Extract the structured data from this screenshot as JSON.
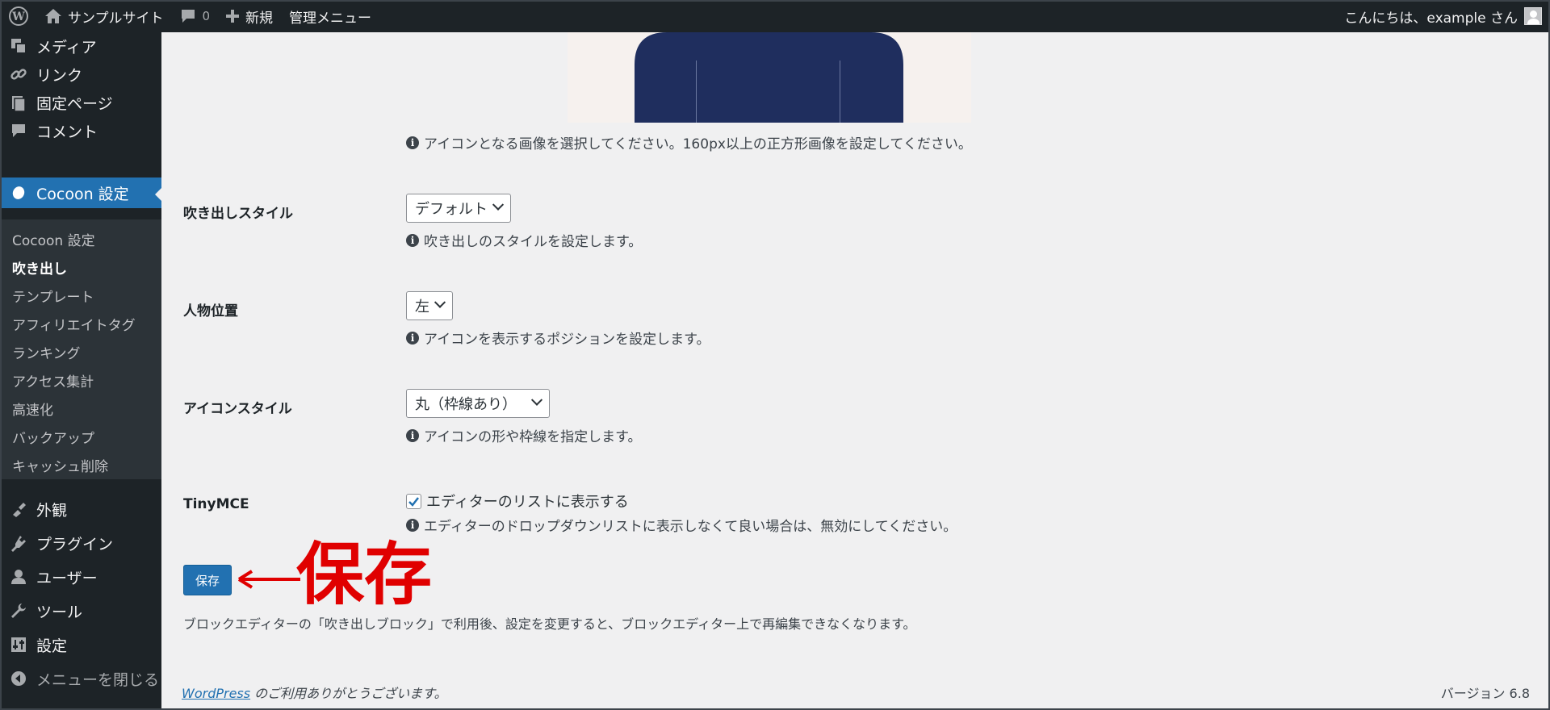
{
  "admin_bar": {
    "site_name": "サンプルサイト",
    "comment_count": "0",
    "new_label": "新規",
    "admin_menu_label": "管理メニュー",
    "greeting": "こんにちは、example さん"
  },
  "sidebar": {
    "items_top": [
      {
        "label": "メディア",
        "icon": "media-icon"
      },
      {
        "label": "リンク",
        "icon": "link-icon"
      },
      {
        "label": "固定ページ",
        "icon": "page-icon"
      },
      {
        "label": "コメント",
        "icon": "comment-icon"
      }
    ],
    "current": {
      "label": "Cocoon 設定",
      "icon": "cocoon-icon"
    },
    "submenu": [
      {
        "label": "Cocoon 設定",
        "current": false
      },
      {
        "label": "吹き出し",
        "current": true
      },
      {
        "label": "テンプレート",
        "current": false
      },
      {
        "label": "アフィリエイトタグ",
        "current": false
      },
      {
        "label": "ランキング",
        "current": false
      },
      {
        "label": "アクセス集計",
        "current": false
      },
      {
        "label": "高速化",
        "current": false
      },
      {
        "label": "バックアップ",
        "current": false
      },
      {
        "label": "キャッシュ削除",
        "current": false
      }
    ],
    "items_bottom": [
      {
        "label": "外観",
        "icon": "appearance-icon"
      },
      {
        "label": "プラグイン",
        "icon": "plugin-icon"
      },
      {
        "label": "ユーザー",
        "icon": "user-icon"
      },
      {
        "label": "ツール",
        "icon": "tool-icon"
      },
      {
        "label": "設定",
        "icon": "settings-icon"
      }
    ],
    "collapse_label": "メニューを閉じる"
  },
  "form": {
    "icon_desc": "アイコンとなる画像を選択してください。160px以上の正方形画像を設定してください。",
    "balloon_style": {
      "label": "吹き出しスタイル",
      "value": "デフォルト",
      "desc": "吹き出しのスタイルを設定します。"
    },
    "position": {
      "label": "人物位置",
      "value": "左",
      "desc": "アイコンを表示するポジションを設定します。"
    },
    "icon_style": {
      "label": "アイコンスタイル",
      "value": "丸（枠線あり）",
      "desc": "アイコンの形や枠線を指定します。"
    },
    "tinymce": {
      "label": "TinyMCE",
      "checkbox_label": "エディターのリストに表示する",
      "checked": true,
      "desc": "エディターのドロップダウンリストに表示しなくて良い場合は、無効にしてください。"
    },
    "save_label": "保存",
    "annotation": "保存",
    "note": "ブロックエディターの「吹き出しブロック」で利用後、設定を変更すると、ブロックエディター上で再編集できなくなります。"
  },
  "footer": {
    "wp_link": "WordPress",
    "thanks": " のご利用ありがとうございます。",
    "version": "バージョン 6.8"
  },
  "colors": {
    "accent": "#2271b1",
    "sidebar_bg": "#1d2327",
    "annotation": "#e00000"
  }
}
